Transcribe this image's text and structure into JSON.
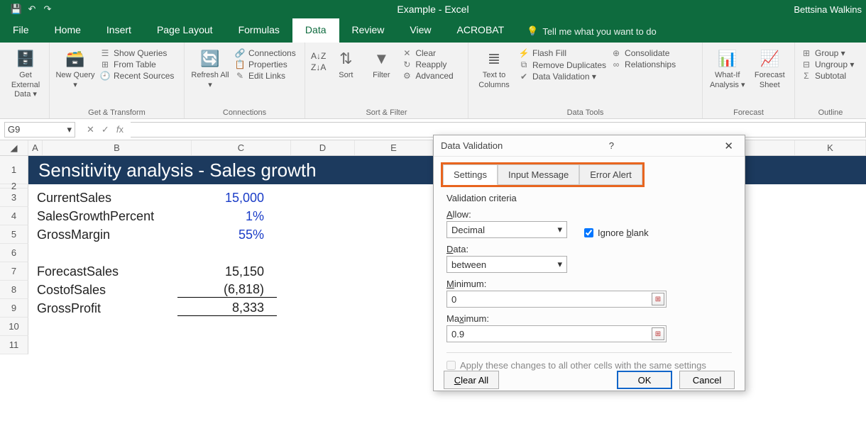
{
  "app": {
    "title": "Example - Excel",
    "user": "Bettsina Walkins"
  },
  "qat": {
    "save": "💾",
    "undo": "↶",
    "redo": "↷"
  },
  "tabs": {
    "file": "File",
    "home": "Home",
    "insert": "Insert",
    "pageLayout": "Page Layout",
    "formulas": "Formulas",
    "data": "Data",
    "review": "Review",
    "view": "View",
    "acrobat": "ACROBAT",
    "tellme": "Tell me what you want to do"
  },
  "ribbon": {
    "getExternal": "Get External Data ▾",
    "newQuery": "New Query ▾",
    "showQueries": "Show Queries",
    "fromTable": "From Table",
    "recentSources": "Recent Sources",
    "grpTransform": "Get & Transform",
    "refreshAll": "Refresh All ▾",
    "connections": "Connections",
    "properties": "Properties",
    "editLinks": "Edit Links",
    "grpConnections": "Connections",
    "sortAZ": "A↓Z",
    "sortZA": "Z↓A",
    "sort": "Sort",
    "filter": "Filter",
    "clear": "Clear",
    "reapply": "Reapply",
    "advanced": "Advanced",
    "grpSortFilter": "Sort & Filter",
    "textToCols": "Text to Columns",
    "flashFill": "Flash Fill",
    "removeDup": "Remove Duplicates",
    "dataValidation": "Data Validation  ▾",
    "consolidate": "Consolidate",
    "relationships": "Relationships",
    "grpDataTools": "Data Tools",
    "whatIf": "What-If Analysis ▾",
    "forecastSheet": "Forecast Sheet",
    "grpForecast": "Forecast",
    "group": "Group  ▾",
    "ungroup": "Ungroup  ▾",
    "subtotal": "Subtotal",
    "grpOutline": "Outline"
  },
  "namebox": "G9",
  "cols": {
    "a": "A",
    "b": "B",
    "c": "C",
    "d": "D",
    "e": "E",
    "k": "K"
  },
  "rows": {
    "r1": "1",
    "r2": "2",
    "r3": "3",
    "r4": "4",
    "r5": "5",
    "r6": "6",
    "r7": "7",
    "r8": "8",
    "r9": "9",
    "r10": "10",
    "r11": "11"
  },
  "sheet": {
    "title": "Sensitivity analysis - Sales growth",
    "r3l": "CurrentSales",
    "r3v": "15,000",
    "r4l": "SalesGrowthPercent",
    "r4v": "1%",
    "r5l": "GrossMargin",
    "r5v": "55%",
    "r7l": "ForecastSales",
    "r7v": "15,150",
    "r8l": "CostofSales",
    "r8v": "(6,818)",
    "r9l": "GrossProfit",
    "r9v": "8,333"
  },
  "dialog": {
    "title": "Data Validation",
    "tabSettings": "Settings",
    "tabInput": "Input Message",
    "tabError": "Error Alert",
    "vcLabel": "Validation criteria",
    "allowLbl": "Allow:",
    "allowVal": "Decimal",
    "ignoreBlank": "Ignore blank",
    "dataLbl": "Data:",
    "dataVal": "between",
    "minLbl": "Minimum:",
    "minVal": "0",
    "maxLbl": "Maximum:",
    "maxVal": "0.9",
    "applyAll": "Apply these changes to all other cells with the same settings",
    "clearAll": "Clear All",
    "ok": "OK",
    "cancel": "Cancel"
  }
}
